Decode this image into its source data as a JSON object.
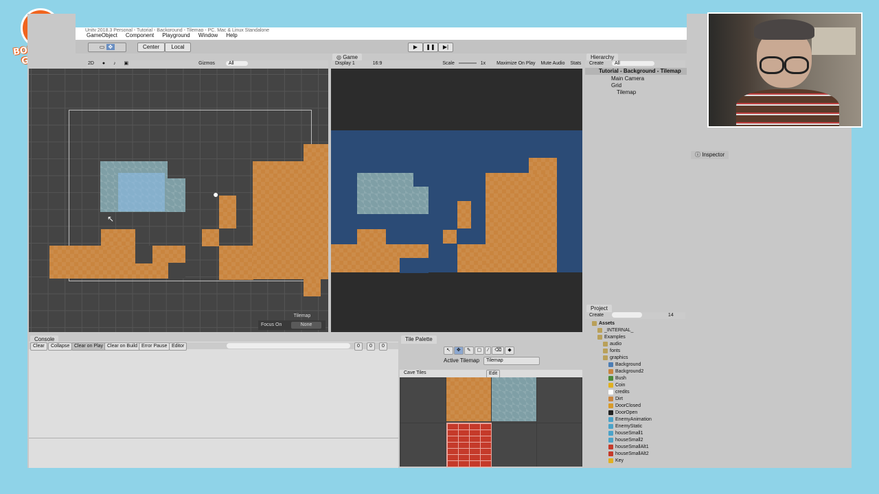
{
  "brand": {
    "logo_text": "BOUNDER GAMES"
  },
  "window": {
    "title": "Unity 2018.3 Personal - Tutorial - Background - Tilemap - PC, Mac & Linux Standalone"
  },
  "menu": [
    "GameObject",
    "Component",
    "Playground",
    "Window",
    "Help"
  ],
  "toolbar": {
    "pivot": "Center",
    "space": "Local"
  },
  "scene": {
    "mode": "2D",
    "gizmos": "Gizmos",
    "search": "All",
    "label": "Tilemap",
    "focus_label": "Focus On",
    "focus_value": "None"
  },
  "game": {
    "tab": "Game",
    "display": "Display 1",
    "aspect": "16:9",
    "scale_label": "Scale",
    "scale_value": "1x",
    "maximize": "Maximize On Play",
    "mute": "Mute Audio",
    "stats": "Stats"
  },
  "hierarchy": {
    "tab": "Hierarchy",
    "create": "Create",
    "search": "All",
    "scene": "Tutorial - Background - Tilemap",
    "items": [
      "Main Camera",
      "Grid",
      "Tilemap"
    ]
  },
  "inspector": {
    "tab": "Inspector"
  },
  "console": {
    "tab": "Console",
    "buttons": [
      "Clear",
      "Collapse",
      "Clear on Play",
      "Clear on Build",
      "Error Pause",
      "Editor"
    ],
    "counts": [
      "0",
      "0",
      "0"
    ]
  },
  "palette": {
    "tab": "Tile Palette",
    "active_label": "Active Tilemap",
    "active_value": "Tilemap",
    "palette_name": "Cave Tiles",
    "edit": "Edit"
  },
  "project": {
    "tab": "Project",
    "create": "Create",
    "count": "14",
    "root": "Assets",
    "items": [
      {
        "label": "_INTERNAL_",
        "depth": 1,
        "color": "#b9a05a"
      },
      {
        "label": "Examples",
        "depth": 1,
        "color": "#b9a05a"
      },
      {
        "label": "audio",
        "depth": 2,
        "color": "#b9a05a"
      },
      {
        "label": "fonts",
        "depth": 2,
        "color": "#b9a05a"
      },
      {
        "label": "graphics",
        "depth": 2,
        "color": "#b9a05a"
      },
      {
        "label": "Background",
        "depth": 3,
        "color": "#4c7db4"
      },
      {
        "label": "Background2",
        "depth": 3,
        "color": "#c9853f"
      },
      {
        "label": "Bush",
        "depth": 3,
        "color": "#4a8a3a"
      },
      {
        "label": "Coin",
        "depth": 3,
        "color": "#e0b020"
      },
      {
        "label": "credits",
        "depth": 3,
        "color": "#ffffff"
      },
      {
        "label": "Dirt",
        "depth": 3,
        "color": "#c9853f"
      },
      {
        "label": "DoorClosed",
        "depth": 3,
        "color": "#d89a2a"
      },
      {
        "label": "DoorOpen",
        "depth": 3,
        "color": "#222222"
      },
      {
        "label": "EnemyAnimation",
        "depth": 3,
        "color": "#4aa3c9"
      },
      {
        "label": "EnemyStatic",
        "depth": 3,
        "color": "#4aa3c9"
      },
      {
        "label": "houseSmall1",
        "depth": 3,
        "color": "#4aa3c9"
      },
      {
        "label": "houseSmall2",
        "depth": 3,
        "color": "#4aa3c9"
      },
      {
        "label": "houseSmallAlt1",
        "depth": 3,
        "color": "#c53a2a"
      },
      {
        "label": "houseSmallAlt2",
        "depth": 3,
        "color": "#c53a2a"
      },
      {
        "label": "Key",
        "depth": 3,
        "color": "#e0b020"
      }
    ]
  }
}
